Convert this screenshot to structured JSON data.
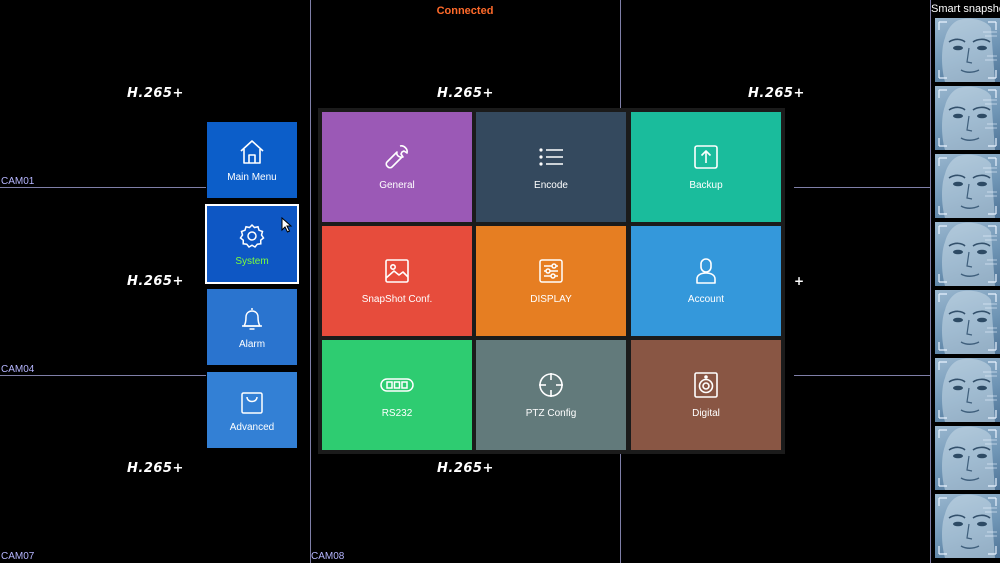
{
  "status": "Connected",
  "snapshot_title": "Smart snapshot",
  "codec_label": "H.265+",
  "plus_label": "+",
  "cameras": {
    "cam01": "CAM01",
    "cam04": "CAM04",
    "cam07": "CAM07",
    "cam08": "CAM08"
  },
  "side_menu": {
    "main_menu": "Main Menu",
    "system": "System",
    "alarm": "Alarm",
    "advanced": "Advanced"
  },
  "tiles": {
    "general": "General",
    "encode": "Encode",
    "backup": "Backup",
    "snapshot": "SnapShot Conf.",
    "display": "DISPLAY",
    "account": "Account",
    "rs232": "RS232",
    "ptz": "PTZ Config",
    "digital": "Digital"
  },
  "colors": {
    "general": "#9b59b6",
    "encode": "#34495e",
    "backup": "#1abc9c",
    "snapshot": "#e74c3c",
    "display": "#e67e22",
    "account": "#3498db",
    "rs232": "#2ecc71",
    "ptz": "#627a7b",
    "digital": "#895644",
    "side_main": "#0c5ec9",
    "side_system": "#0e57c4",
    "side_alarm": "#2a74cf",
    "side_advanced": "#3380d5",
    "status": "#ff6a2a"
  }
}
